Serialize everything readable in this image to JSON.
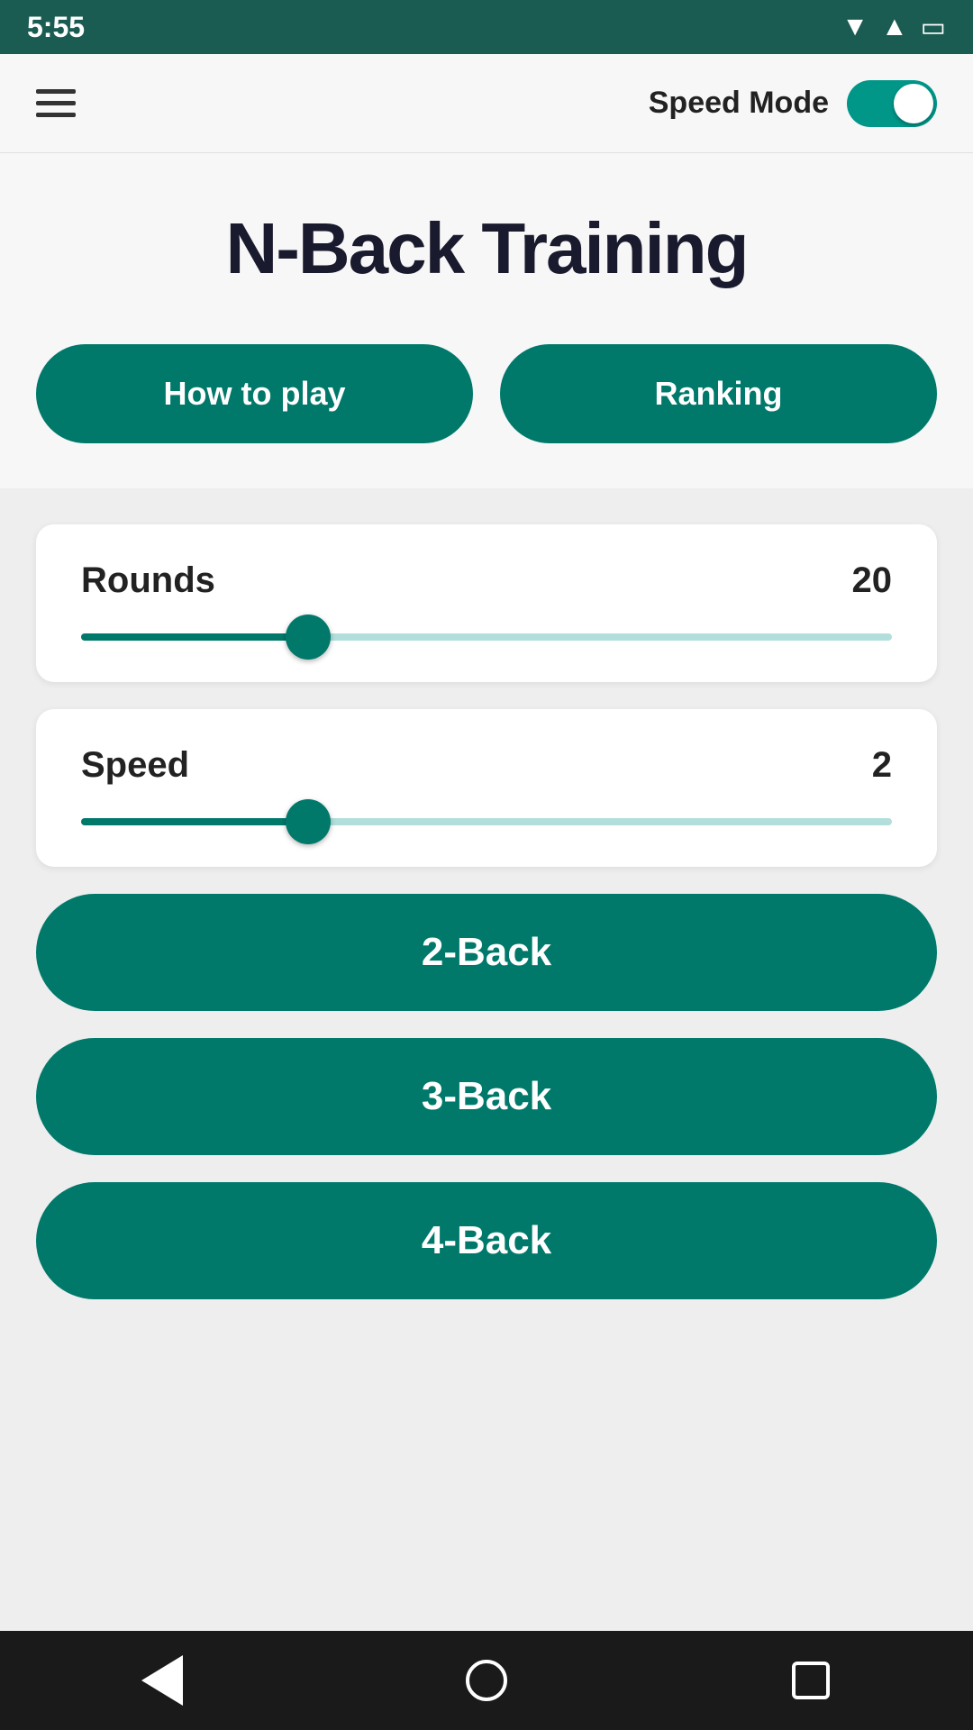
{
  "statusBar": {
    "time": "5:55"
  },
  "topBar": {
    "speedModeLabel": "Speed Mode"
  },
  "hero": {
    "title": "N-Back Training",
    "howToPlayLabel": "How to play",
    "rankingLabel": "Ranking"
  },
  "rounds": {
    "label": "Rounds",
    "value": "20",
    "fillPercent": 28
  },
  "speed": {
    "label": "Speed",
    "value": "2",
    "fillPercent": 28
  },
  "buttons": {
    "twoBack": "2-Back",
    "threeBack": "3-Back",
    "fourBack": "4-Back"
  },
  "navBar": {
    "back": "back",
    "home": "home",
    "recents": "recents"
  }
}
